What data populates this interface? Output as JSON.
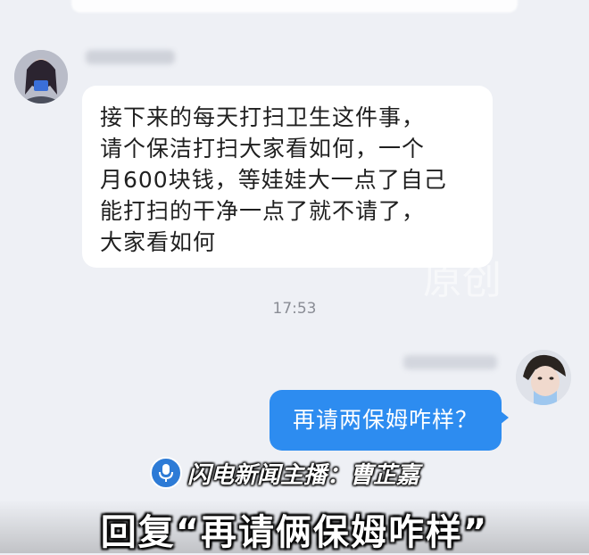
{
  "header": {
    "banner_text": ""
  },
  "chat": {
    "incoming": {
      "text": "接下来的每天打扫卫生这件事，\n请个保洁打扫大家看如何，一个\n月600块钱，等娃娃大一点了自己\n能打扫的干净一点了就不请了，\n大家看如何"
    },
    "timestamp": "17:53",
    "outgoing": {
      "text": "再请两保姆咋样？"
    }
  },
  "overlay": {
    "watermark_small": "",
    "watermark_large": "原创",
    "broadcaster_label": "闪电新闻主播：曹芷嘉",
    "caption": "回复“再请俩保姆咋样”"
  },
  "colors": {
    "background": "#eef0f5",
    "outgoing_bubble": "#2d8cf0",
    "incoming_bubble": "#ffffff"
  },
  "icons": {
    "broadcaster": "microphone-icon"
  }
}
